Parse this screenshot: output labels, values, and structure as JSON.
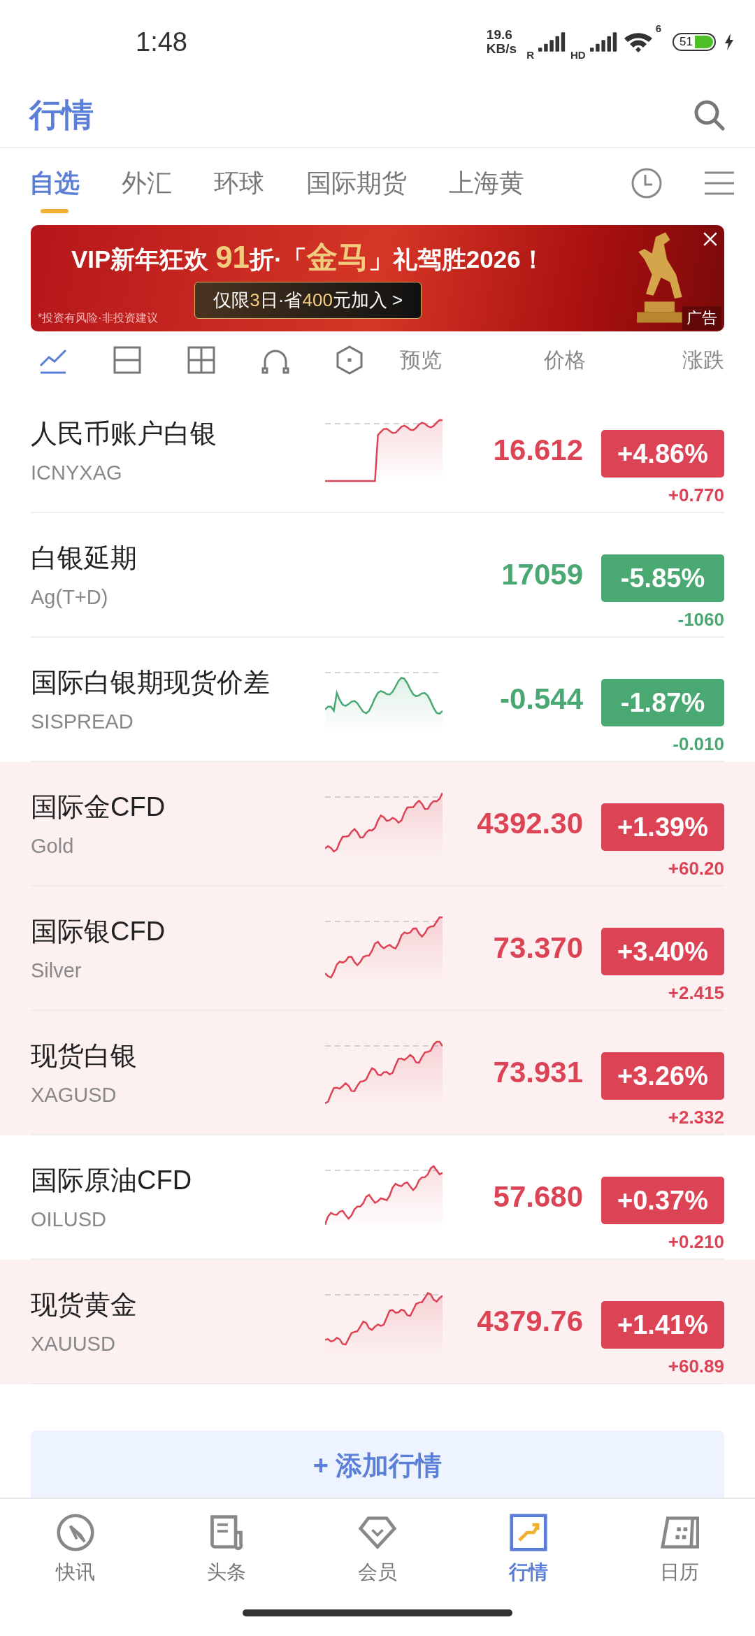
{
  "status_bar": {
    "time": "1:48",
    "speed_value": "19.6",
    "speed_unit": "KB/s",
    "sim1_label": "R",
    "sim2_label": "HD",
    "wifi_label": "6",
    "battery": "51"
  },
  "header": {
    "title": "行情"
  },
  "tabs": [
    {
      "label": "自选",
      "selected": true
    },
    {
      "label": "外汇",
      "selected": false
    },
    {
      "label": "环球",
      "selected": false
    },
    {
      "label": "国际期货",
      "selected": false
    },
    {
      "label": "上海黄",
      "selected": false
    }
  ],
  "banner": {
    "headline": [
      {
        "text": "VIP新年狂欢 ",
        "highlight": false
      },
      {
        "text": "91",
        "highlight": true
      },
      {
        "text": "折·「",
        "highlight": false
      },
      {
        "text": "金马",
        "highlight": true
      },
      {
        "text": "」礼驾胜2026！",
        "highlight": false
      }
    ],
    "cta": [
      {
        "text": "仅限",
        "highlight": false
      },
      {
        "text": "3",
        "highlight": true
      },
      {
        "text": "日·省",
        "highlight": false
      },
      {
        "text": "400",
        "highlight": true
      },
      {
        "text": "元加入 >",
        "highlight": false
      }
    ],
    "disclaimer": "*投资有风险·非投资建议",
    "ad_label": "广告"
  },
  "view_modes": [
    {
      "kind": "line",
      "selected": true
    },
    {
      "kind": "split",
      "selected": false
    },
    {
      "kind": "grid",
      "selected": false
    },
    {
      "kind": "arch",
      "selected": false
    },
    {
      "kind": "hexagon",
      "selected": false
    }
  ],
  "columns": [
    "预览",
    "价格",
    "涨跌"
  ],
  "quotes": [
    {
      "name": "人民币账户白银",
      "code": "ICNYXAG",
      "price": "16.612",
      "change_pct": "+4.86%",
      "change": "+0.770",
      "rising": true,
      "highlighted": false,
      "has_sparkline": true
    },
    {
      "name": "白银延期",
      "code": "Ag(T+D)",
      "price": "17059",
      "change_pct": "-5.85%",
      "change": "-1060",
      "rising": false,
      "highlighted": false,
      "has_sparkline": false
    },
    {
      "name": "国际白银期现货价差",
      "code": "SISPREAD",
      "price": "-0.544",
      "change_pct": "-1.87%",
      "change": "-0.010",
      "rising": false,
      "highlighted": false,
      "has_sparkline": true
    },
    {
      "name": "国际金CFD",
      "code": "Gold",
      "price": "4392.30",
      "change_pct": "+1.39%",
      "change": "+60.20",
      "rising": true,
      "highlighted": true,
      "has_sparkline": true
    },
    {
      "name": "国际银CFD",
      "code": "Silver",
      "price": "73.370",
      "change_pct": "+3.40%",
      "change": "+2.415",
      "rising": true,
      "highlighted": true,
      "has_sparkline": true
    },
    {
      "name": "现货白银",
      "code": "XAGUSD",
      "price": "73.931",
      "change_pct": "+3.26%",
      "change": "+2.332",
      "rising": true,
      "highlighted": true,
      "has_sparkline": true
    },
    {
      "name": "国际原油CFD",
      "code": "OILUSD",
      "price": "57.680",
      "change_pct": "+0.37%",
      "change": "+0.210",
      "rising": true,
      "highlighted": false,
      "has_sparkline": true
    },
    {
      "name": "现货黄金",
      "code": "XAUUSD",
      "price": "4379.76",
      "change_pct": "+1.41%",
      "change": "+60.89",
      "rising": true,
      "highlighted": true,
      "has_sparkline": true
    }
  ],
  "add_button": "+ 添加行情",
  "bottom_nav": [
    {
      "kind": "flash",
      "label": "快讯",
      "selected": false
    },
    {
      "kind": "news",
      "label": "头条",
      "selected": false
    },
    {
      "kind": "vip",
      "label": "会员",
      "selected": false
    },
    {
      "kind": "market",
      "label": "行情",
      "selected": true
    },
    {
      "kind": "calendar",
      "label": "日历",
      "selected": false
    }
  ]
}
